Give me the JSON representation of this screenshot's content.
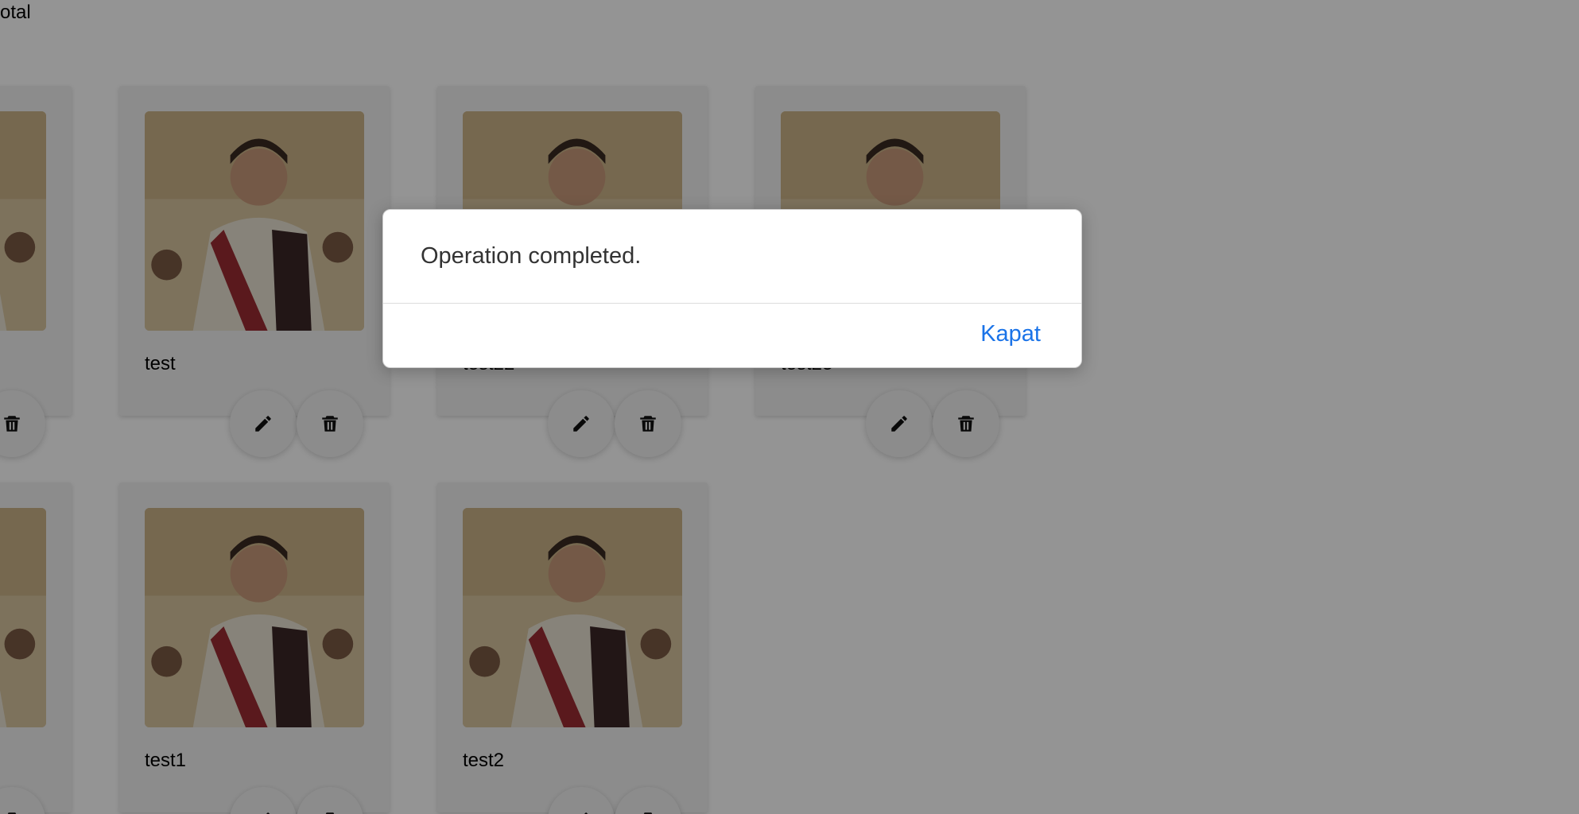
{
  "header": {
    "partial_label": "otal"
  },
  "cards": [
    {
      "name": ""
    },
    {
      "name": "test"
    },
    {
      "name": "test22"
    },
    {
      "name": "test23"
    },
    {
      "name": ""
    },
    {
      "name": "test1"
    },
    {
      "name": "test2"
    }
  ],
  "icons": {
    "edit": "pencil-icon",
    "delete": "trash-icon"
  },
  "dialog": {
    "message": "Operation completed.",
    "close_label": "Kapat"
  },
  "colors": {
    "overlay": "#000000",
    "link": "#1a73e8",
    "card_bg": "#f2f2f2"
  }
}
